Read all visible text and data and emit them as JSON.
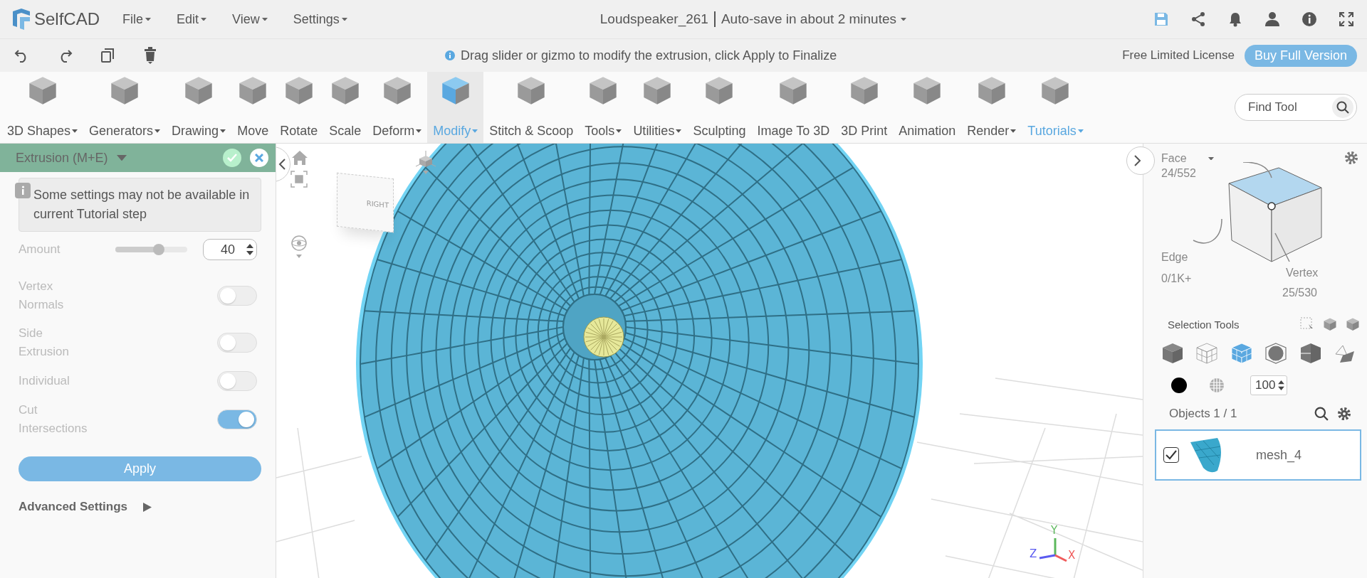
{
  "app": {
    "name": "SelfCAD"
  },
  "menu": [
    {
      "label": "File"
    },
    {
      "label": "Edit"
    },
    {
      "label": "View"
    },
    {
      "label": "Settings"
    }
  ],
  "document": {
    "title": "Loudspeaker_261",
    "autosave": "Auto-save in about 2 minutes"
  },
  "hint": "Drag slider or gizmo to modify the extrusion, click Apply to Finalize",
  "license": "Free Limited License",
  "buy_button": "Buy Full Version",
  "tools": [
    {
      "label": "3D Shapes",
      "dropdown": true,
      "selected": false,
      "accent": false
    },
    {
      "label": "Generators",
      "dropdown": true,
      "selected": false,
      "accent": false
    },
    {
      "label": "Drawing",
      "dropdown": true,
      "selected": false,
      "accent": false
    },
    {
      "label": "Move",
      "dropdown": false,
      "selected": false,
      "accent": false
    },
    {
      "label": "Rotate",
      "dropdown": false,
      "selected": false,
      "accent": false
    },
    {
      "label": "Scale",
      "dropdown": false,
      "selected": false,
      "accent": false
    },
    {
      "label": "Deform",
      "dropdown": true,
      "selected": false,
      "accent": false
    },
    {
      "label": "Modify",
      "dropdown": true,
      "selected": true,
      "accent": true
    },
    {
      "label": "Stitch & Scoop",
      "dropdown": false,
      "selected": false,
      "accent": false
    },
    {
      "label": "Tools",
      "dropdown": true,
      "selected": false,
      "accent": false
    },
    {
      "label": "Utilities",
      "dropdown": true,
      "selected": false,
      "accent": false
    },
    {
      "label": "Sculpting",
      "dropdown": false,
      "selected": false,
      "accent": false
    },
    {
      "label": "Image To 3D",
      "dropdown": false,
      "selected": false,
      "accent": false
    },
    {
      "label": "3D Print",
      "dropdown": false,
      "selected": false,
      "accent": false
    },
    {
      "label": "Animation",
      "dropdown": false,
      "selected": false,
      "accent": false
    },
    {
      "label": "Render",
      "dropdown": true,
      "selected": false,
      "accent": false
    },
    {
      "label": "Tutorials",
      "dropdown": true,
      "selected": false,
      "accent": true
    }
  ],
  "search": {
    "placeholder": "Find Tool"
  },
  "panel": {
    "title": "Extrusion (M+E)",
    "note": "Some settings may not be available in current Tutorial step",
    "amount": {
      "label": "Amount",
      "level": 0.6,
      "value": "40"
    },
    "toggles": [
      {
        "label": "Vertex Normals",
        "on": false
      },
      {
        "label": "Side Extrusion",
        "on": false
      },
      {
        "label": "Individual",
        "on": false
      },
      {
        "label": "Cut Intersections",
        "on": true
      }
    ],
    "apply": "Apply",
    "advanced": "Advanced Settings"
  },
  "viewport": {
    "view_cube": "RIGHT",
    "axes": [
      {
        "label": "Y",
        "color": "#5cb85c"
      },
      {
        "label": "Z",
        "color": "#5b5bf0"
      },
      {
        "label": "X",
        "color": "#f05b5b"
      }
    ]
  },
  "selection": {
    "face": {
      "label": "Face",
      "count": "24/552"
    },
    "edge": {
      "label": "Edge",
      "count": "0/1K+"
    },
    "vertex": {
      "label": "Vertex",
      "count": "25/530"
    },
    "tools_label": "Selection Tools",
    "modes": [
      {
        "kind": "solid",
        "selected": false
      },
      {
        "kind": "wireframe",
        "selected": false
      },
      {
        "kind": "grid",
        "selected": true
      },
      {
        "kind": "xray",
        "selected": false
      },
      {
        "kind": "split",
        "selected": false
      },
      {
        "kind": "plane",
        "selected": false
      }
    ],
    "opacity": "100"
  },
  "objects": {
    "title": "Objects 1 / 1",
    "items": [
      {
        "name": "mesh_4",
        "checked": true,
        "selected": true
      }
    ]
  }
}
